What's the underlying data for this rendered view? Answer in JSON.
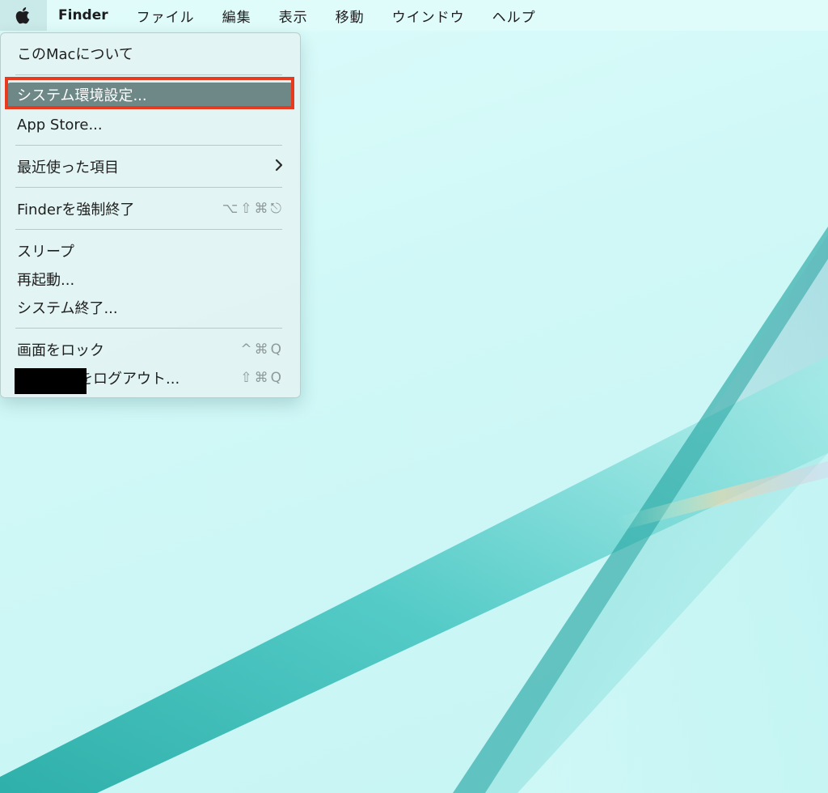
{
  "menubar": {
    "apple_icon": "apple-logo-icon",
    "items": [
      "Finder",
      "ファイル",
      "編集",
      "表示",
      "移動",
      "ウインドウ",
      "ヘルプ"
    ]
  },
  "apple_menu": {
    "about": "このMacについて",
    "system_preferences": "システム環境設定...",
    "app_store": "App Store...",
    "recent_items": "最近使った項目",
    "recent_items_icon": "chevron-right-icon",
    "force_quit": "Finderを強制終了",
    "force_quit_shortcut": "⌥⇧⌘⎋",
    "sleep": "スリープ",
    "restart": "再起動...",
    "shutdown": "システム終了...",
    "lock_screen": "画面をロック",
    "lock_screen_shortcut": "^⌘Q",
    "logout": "をログアウト...",
    "logout_shortcut": "⇧⌘Q"
  },
  "colors": {
    "highlight_frame": "#e83a1e",
    "selected_row": "#6e8888",
    "wallpaper_teal": "#2fb8b4"
  }
}
